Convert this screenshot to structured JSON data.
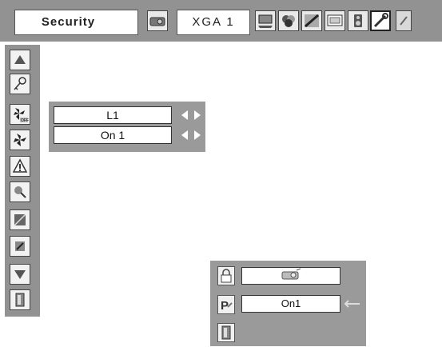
{
  "window": {
    "menu_title": "Security",
    "input_source": "XGA 1"
  },
  "toolbar": {
    "icons": [
      "projector-icon",
      "display-icon",
      "color-icon",
      "image-adjust-icon",
      "screen-icon",
      "sound-icon",
      "setting-icon",
      "expand-icon"
    ],
    "selected": "setting-icon"
  },
  "sidebar": {
    "items": [
      {
        "icon": "arrow-up-icon"
      },
      {
        "icon": "key-icon"
      },
      {
        "icon": "fan-off-icon"
      },
      {
        "icon": "fan-icon"
      },
      {
        "icon": "warning-icon"
      },
      {
        "icon": "filter-icon"
      },
      {
        "icon": "pattern-icon"
      },
      {
        "icon": "lamp-icon"
      },
      {
        "icon": "arrow-down-icon"
      },
      {
        "icon": "exit-icon"
      }
    ]
  },
  "submenu": {
    "fields": [
      {
        "value": "L1"
      },
      {
        "value": "On 1"
      }
    ]
  },
  "dialog": {
    "rows": [
      {
        "icon": "lock-icon",
        "value_icon": "projector-icon"
      },
      {
        "icon": "pin-code-icon",
        "value": "On1"
      },
      {
        "icon": "exit-icon"
      }
    ]
  },
  "colors": {
    "panel": "#929292",
    "submenu_panel": "#9a9a9a",
    "field_bg": "#ffffff",
    "border": "#444444"
  }
}
